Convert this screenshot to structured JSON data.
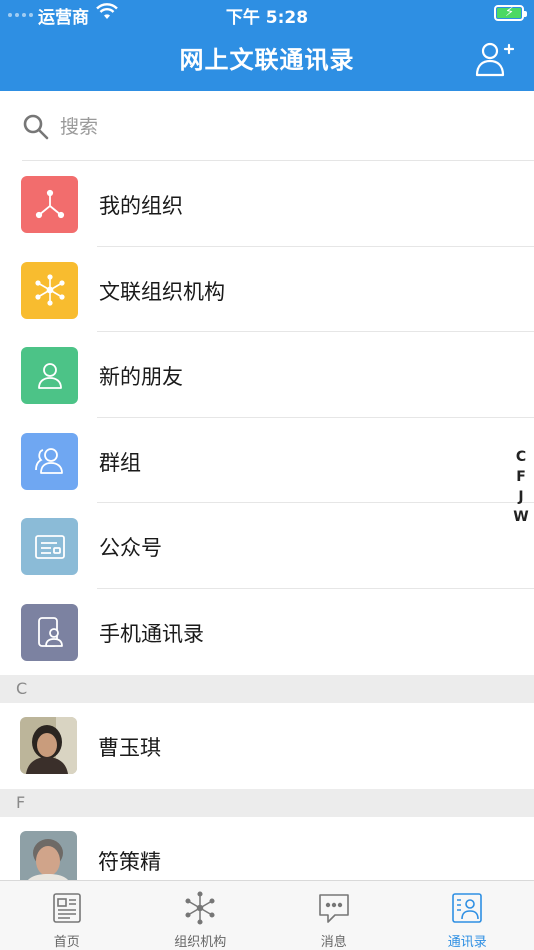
{
  "status_bar": {
    "carrier": "运营商",
    "time": "下午 5:28"
  },
  "nav": {
    "title": "网上文联通讯录",
    "add_contact_icon": "add-contact-icon"
  },
  "search": {
    "placeholder": "搜索"
  },
  "menu": [
    {
      "label": "我的组织",
      "icon": "organization-icon",
      "color": "#f26d6d"
    },
    {
      "label": "文联组织机构",
      "icon": "network-icon",
      "color": "#f8bc2f"
    },
    {
      "label": "新的朋友",
      "icon": "person-icon",
      "color": "#4cc387"
    },
    {
      "label": "群组",
      "icon": "group-icon",
      "color": "#6fa7f2"
    },
    {
      "label": "公众号",
      "icon": "public-account-icon",
      "color": "#8bbbd7"
    },
    {
      "label": "手机通讯录",
      "icon": "phone-contacts-icon",
      "color": "#7c82a1"
    }
  ],
  "index_letters": [
    "C",
    "F",
    "J",
    "W"
  ],
  "sections": [
    {
      "letter": "C",
      "contacts": [
        {
          "name": "曹玉琪"
        }
      ]
    },
    {
      "letter": "F",
      "contacts": [
        {
          "name": "符策精"
        }
      ]
    }
  ],
  "tabbar": {
    "active": 3,
    "tabs": [
      {
        "label": "首页",
        "icon": "home-icon"
      },
      {
        "label": "组织机构",
        "icon": "organization-network-icon"
      },
      {
        "label": "消息",
        "icon": "message-icon"
      },
      {
        "label": "通讯录",
        "icon": "contacts-icon"
      }
    ]
  },
  "colors": {
    "primary": "#2e8fe3",
    "section_bg": "#ececec",
    "tab_active": "#2e8fe3"
  }
}
